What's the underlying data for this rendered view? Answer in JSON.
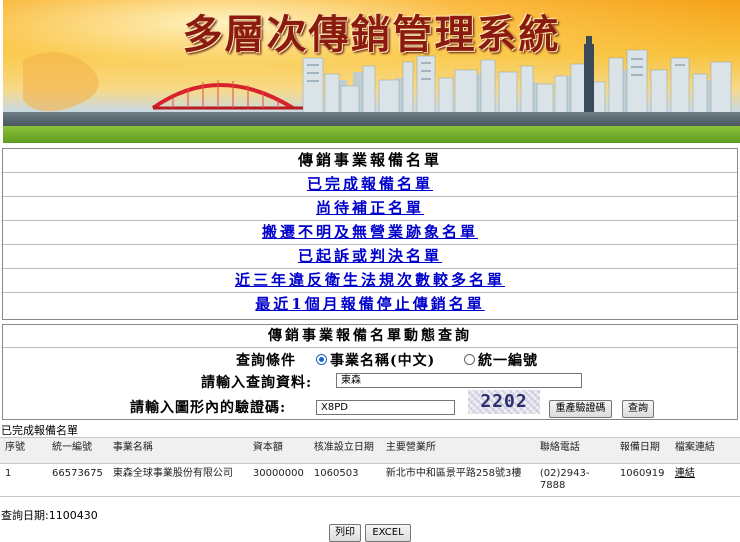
{
  "banner": {
    "title": "多層次傳銷管理系統"
  },
  "links": {
    "header": "傳銷事業報備名單",
    "items": [
      "已完成報備名單",
      "尚待補正名單",
      "搬遷不明及無營業跡象名單",
      "已起訴或判決名單",
      "近三年違反衛生法規次數較多名單",
      "最近1個月報備停止傳銷名單"
    ]
  },
  "query": {
    "title": "傳銷事業報備名單動態查詢",
    "condition_label": "查詢條件",
    "radio_name": "事業名稱(中文)",
    "radio_id": "統一編號",
    "selected": "name",
    "input_label": "請輸入查詢資料:",
    "input_value": "東森",
    "captcha_label": "請輸入圖形內的驗證碼:",
    "captcha_input_value": "X8PD",
    "captcha_text": "2202",
    "regen_button": "重產驗證碼",
    "search_button": "查詢"
  },
  "results": {
    "section_label": "已完成報備名單",
    "columns": [
      "序號",
      "統一編號",
      "事業名稱",
      "資本額",
      "核准設立日期",
      "主要營業所",
      "聯絡電話",
      "報備日期",
      "檔案連結"
    ],
    "rows": [
      {
        "seq": "1",
        "tax_id": "66573675",
        "name": "東森全球事業股份有限公司",
        "capital": "30000000",
        "approved_date": "1060503",
        "address": "新北市中和區景平路258號3樓",
        "phone": "(02)2943-7888",
        "report_date": "1060919",
        "link": "連結"
      }
    ]
  },
  "footer": {
    "query_date": "查詢日期:1100430",
    "print_button": "列印",
    "excel_button": "EXCEL"
  },
  "colors": {
    "link": "#0000cc",
    "banner_title": "#8b1a10",
    "radio_selected": "#1a5fc8"
  }
}
